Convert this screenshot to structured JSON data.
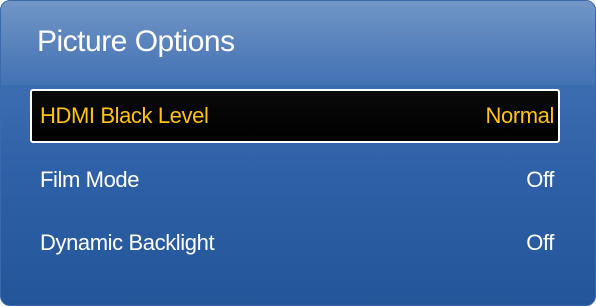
{
  "panel": {
    "title": "Picture Options"
  },
  "menu": {
    "items": [
      {
        "label": "HDMI Black Level",
        "value": "Normal",
        "selected": true
      },
      {
        "label": "Film Mode",
        "value": "Off",
        "selected": false
      },
      {
        "label": "Dynamic Backlight",
        "value": "Off",
        "selected": false
      }
    ]
  },
  "colors": {
    "panel_blue": "#2f61a8",
    "highlight_bg": "#000000",
    "highlight_text": "#ffc20e",
    "text": "#ffffff"
  }
}
